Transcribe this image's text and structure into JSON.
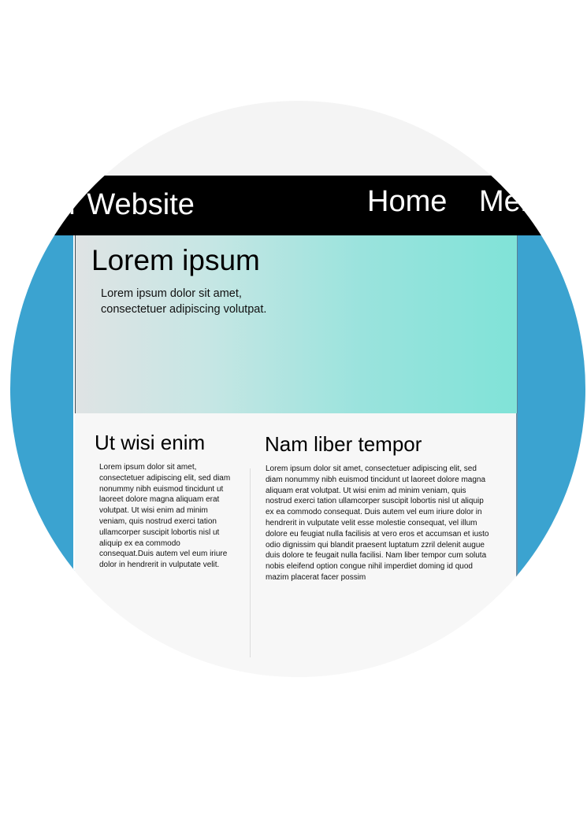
{
  "nav": {
    "logo": "Your Website",
    "links": [
      "Home",
      "Menu"
    ]
  },
  "hero": {
    "title": "Lorem ipsum",
    "text": "Lorem ipsum dolor sit amet, consectetuer adipiscing volutpat."
  },
  "columns": [
    {
      "title": "Ut wisi enim",
      "text": "Lorem ipsum dolor sit amet, consectetuer adipiscing elit, sed diam nonummy nibh euismod tincidunt ut laoreet dolore magna aliquam erat volutpat. Ut wisi enim ad minim veniam, quis nostrud exerci tation ullamcorper suscipit lobortis nisl ut aliquip ex ea commodo consequat.Duis autem vel eum iriure dolor in hendrerit in vulputate velit."
    },
    {
      "title": "Nam liber tempor",
      "text": "Lorem ipsum dolor sit amet, consectetuer adipiscing elit, sed diam nonummy nibh euismod tincidunt ut laoreet dolore magna aliquam erat volutpat. Ut wisi enim ad minim veniam, quis nostrud exerci tation ullamcorper suscipit lobortis nisl ut aliquip ex ea commodo consequat. Duis autem vel eum iriure dolor in hendrerit in vulputate velit esse molestie consequat, vel illum dolore eu feugiat nulla facilisis at vero eros et accumsan et iusto odio dignissim qui blandit praesent luptatum zzril delenit augue duis dolore te feugait nulla facilisi. Nam liber tempor cum soluta nobis eleifend option congue nihil imperdiet doming id quod mazim placerat facer possim"
    }
  ],
  "colors": {
    "navbar": "#000000",
    "side_panel": "#3ba3d0",
    "hero_gradient_start": "#dfe3e4",
    "hero_gradient_end": "#80e3d8",
    "content_bg": "#f7f7f7",
    "disc_bg": "#f4f4f4"
  }
}
